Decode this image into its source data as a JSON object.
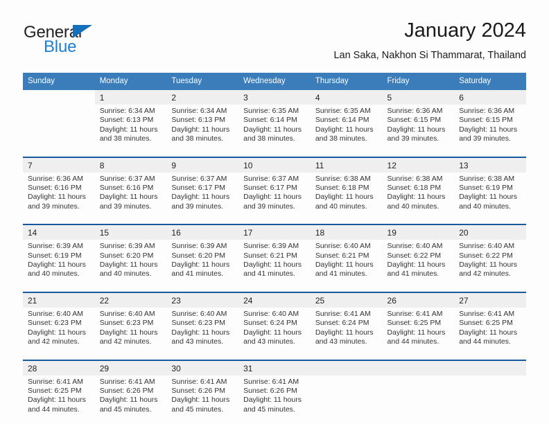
{
  "brand": {
    "word_one": "General",
    "word_two": "Blue",
    "triangle_icon": "triangle-icon",
    "color_dark": "#231f20",
    "color_blue": "#1d7fd4"
  },
  "header": {
    "title": "January 2024",
    "location": "Lan Saka, Nakhon Si Thammarat, Thailand"
  },
  "theme": {
    "header_blue": "#3b7cba",
    "separator_blue": "#15599e",
    "daynum_gray": "#efefef"
  },
  "calendar": {
    "weekdays": [
      "Sunday",
      "Monday",
      "Tuesday",
      "Wednesday",
      "Thursday",
      "Friday",
      "Saturday"
    ],
    "weeks": [
      {
        "days": [
          {
            "num": "",
            "sunrise": "",
            "sunset": "",
            "daylight_1": "",
            "daylight_2": ""
          },
          {
            "num": "1",
            "sunrise": "Sunrise: 6:34 AM",
            "sunset": "Sunset: 6:13 PM",
            "daylight_1": "Daylight: 11 hours",
            "daylight_2": "and 38 minutes."
          },
          {
            "num": "2",
            "sunrise": "Sunrise: 6:34 AM",
            "sunset": "Sunset: 6:13 PM",
            "daylight_1": "Daylight: 11 hours",
            "daylight_2": "and 38 minutes."
          },
          {
            "num": "3",
            "sunrise": "Sunrise: 6:35 AM",
            "sunset": "Sunset: 6:14 PM",
            "daylight_1": "Daylight: 11 hours",
            "daylight_2": "and 38 minutes."
          },
          {
            "num": "4",
            "sunrise": "Sunrise: 6:35 AM",
            "sunset": "Sunset: 6:14 PM",
            "daylight_1": "Daylight: 11 hours",
            "daylight_2": "and 38 minutes."
          },
          {
            "num": "5",
            "sunrise": "Sunrise: 6:36 AM",
            "sunset": "Sunset: 6:15 PM",
            "daylight_1": "Daylight: 11 hours",
            "daylight_2": "and 39 minutes."
          },
          {
            "num": "6",
            "sunrise": "Sunrise: 6:36 AM",
            "sunset": "Sunset: 6:15 PM",
            "daylight_1": "Daylight: 11 hours",
            "daylight_2": "and 39 minutes."
          }
        ]
      },
      {
        "days": [
          {
            "num": "7",
            "sunrise": "Sunrise: 6:36 AM",
            "sunset": "Sunset: 6:16 PM",
            "daylight_1": "Daylight: 11 hours",
            "daylight_2": "and 39 minutes."
          },
          {
            "num": "8",
            "sunrise": "Sunrise: 6:37 AM",
            "sunset": "Sunset: 6:16 PM",
            "daylight_1": "Daylight: 11 hours",
            "daylight_2": "and 39 minutes."
          },
          {
            "num": "9",
            "sunrise": "Sunrise: 6:37 AM",
            "sunset": "Sunset: 6:17 PM",
            "daylight_1": "Daylight: 11 hours",
            "daylight_2": "and 39 minutes."
          },
          {
            "num": "10",
            "sunrise": "Sunrise: 6:37 AM",
            "sunset": "Sunset: 6:17 PM",
            "daylight_1": "Daylight: 11 hours",
            "daylight_2": "and 39 minutes."
          },
          {
            "num": "11",
            "sunrise": "Sunrise: 6:38 AM",
            "sunset": "Sunset: 6:18 PM",
            "daylight_1": "Daylight: 11 hours",
            "daylight_2": "and 40 minutes."
          },
          {
            "num": "12",
            "sunrise": "Sunrise: 6:38 AM",
            "sunset": "Sunset: 6:18 PM",
            "daylight_1": "Daylight: 11 hours",
            "daylight_2": "and 40 minutes."
          },
          {
            "num": "13",
            "sunrise": "Sunrise: 6:38 AM",
            "sunset": "Sunset: 6:19 PM",
            "daylight_1": "Daylight: 11 hours",
            "daylight_2": "and 40 minutes."
          }
        ]
      },
      {
        "days": [
          {
            "num": "14",
            "sunrise": "Sunrise: 6:39 AM",
            "sunset": "Sunset: 6:19 PM",
            "daylight_1": "Daylight: 11 hours",
            "daylight_2": "and 40 minutes."
          },
          {
            "num": "15",
            "sunrise": "Sunrise: 6:39 AM",
            "sunset": "Sunset: 6:20 PM",
            "daylight_1": "Daylight: 11 hours",
            "daylight_2": "and 40 minutes."
          },
          {
            "num": "16",
            "sunrise": "Sunrise: 6:39 AM",
            "sunset": "Sunset: 6:20 PM",
            "daylight_1": "Daylight: 11 hours",
            "daylight_2": "and 41 minutes."
          },
          {
            "num": "17",
            "sunrise": "Sunrise: 6:39 AM",
            "sunset": "Sunset: 6:21 PM",
            "daylight_1": "Daylight: 11 hours",
            "daylight_2": "and 41 minutes."
          },
          {
            "num": "18",
            "sunrise": "Sunrise: 6:40 AM",
            "sunset": "Sunset: 6:21 PM",
            "daylight_1": "Daylight: 11 hours",
            "daylight_2": "and 41 minutes."
          },
          {
            "num": "19",
            "sunrise": "Sunrise: 6:40 AM",
            "sunset": "Sunset: 6:22 PM",
            "daylight_1": "Daylight: 11 hours",
            "daylight_2": "and 41 minutes."
          },
          {
            "num": "20",
            "sunrise": "Sunrise: 6:40 AM",
            "sunset": "Sunset: 6:22 PM",
            "daylight_1": "Daylight: 11 hours",
            "daylight_2": "and 42 minutes."
          }
        ]
      },
      {
        "days": [
          {
            "num": "21",
            "sunrise": "Sunrise: 6:40 AM",
            "sunset": "Sunset: 6:23 PM",
            "daylight_1": "Daylight: 11 hours",
            "daylight_2": "and 42 minutes."
          },
          {
            "num": "22",
            "sunrise": "Sunrise: 6:40 AM",
            "sunset": "Sunset: 6:23 PM",
            "daylight_1": "Daylight: 11 hours",
            "daylight_2": "and 42 minutes."
          },
          {
            "num": "23",
            "sunrise": "Sunrise: 6:40 AM",
            "sunset": "Sunset: 6:23 PM",
            "daylight_1": "Daylight: 11 hours",
            "daylight_2": "and 43 minutes."
          },
          {
            "num": "24",
            "sunrise": "Sunrise: 6:40 AM",
            "sunset": "Sunset: 6:24 PM",
            "daylight_1": "Daylight: 11 hours",
            "daylight_2": "and 43 minutes."
          },
          {
            "num": "25",
            "sunrise": "Sunrise: 6:41 AM",
            "sunset": "Sunset: 6:24 PM",
            "daylight_1": "Daylight: 11 hours",
            "daylight_2": "and 43 minutes."
          },
          {
            "num": "26",
            "sunrise": "Sunrise: 6:41 AM",
            "sunset": "Sunset: 6:25 PM",
            "daylight_1": "Daylight: 11 hours",
            "daylight_2": "and 44 minutes."
          },
          {
            "num": "27",
            "sunrise": "Sunrise: 6:41 AM",
            "sunset": "Sunset: 6:25 PM",
            "daylight_1": "Daylight: 11 hours",
            "daylight_2": "and 44 minutes."
          }
        ]
      },
      {
        "days": [
          {
            "num": "28",
            "sunrise": "Sunrise: 6:41 AM",
            "sunset": "Sunset: 6:25 PM",
            "daylight_1": "Daylight: 11 hours",
            "daylight_2": "and 44 minutes."
          },
          {
            "num": "29",
            "sunrise": "Sunrise: 6:41 AM",
            "sunset": "Sunset: 6:26 PM",
            "daylight_1": "Daylight: 11 hours",
            "daylight_2": "and 45 minutes."
          },
          {
            "num": "30",
            "sunrise": "Sunrise: 6:41 AM",
            "sunset": "Sunset: 6:26 PM",
            "daylight_1": "Daylight: 11 hours",
            "daylight_2": "and 45 minutes."
          },
          {
            "num": "31",
            "sunrise": "Sunrise: 6:41 AM",
            "sunset": "Sunset: 6:26 PM",
            "daylight_1": "Daylight: 11 hours",
            "daylight_2": "and 45 minutes."
          },
          {
            "num": "",
            "sunrise": "",
            "sunset": "",
            "daylight_1": "",
            "daylight_2": ""
          },
          {
            "num": "",
            "sunrise": "",
            "sunset": "",
            "daylight_1": "",
            "daylight_2": ""
          },
          {
            "num": "",
            "sunrise": "",
            "sunset": "",
            "daylight_1": "",
            "daylight_2": ""
          }
        ]
      }
    ]
  }
}
